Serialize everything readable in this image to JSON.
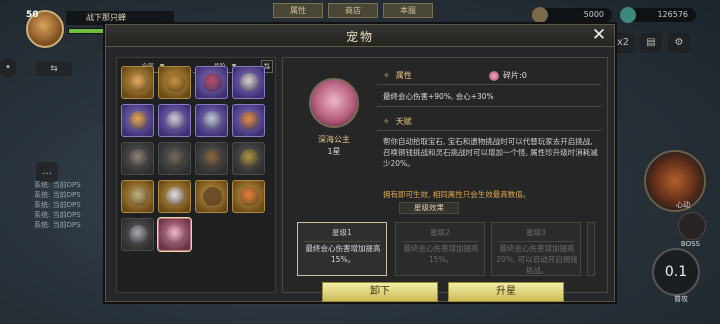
{
  "hud": {
    "level": "50",
    "player_name": "战下那只蝉",
    "top_tabs": [
      "属性",
      "商店",
      "本服"
    ],
    "gold": "5000",
    "gems": "126576",
    "speed": "x2",
    "boss_label": "BOSS",
    "skill_label": "心动",
    "auto_timer": "0.1",
    "auto_label": "普攻"
  },
  "chatlog": [
    "系统: 当前DPS",
    "系统: 当前DPS",
    "系统: 当前DPS",
    "系统: 当前DPS",
    "系统: 当前DPS"
  ],
  "modal": {
    "title": "宠物",
    "close_label": "✕"
  },
  "pet_list": {
    "filter_all": "全部",
    "filter_quality": "品阶",
    "cells": [
      {
        "rarity": "gold",
        "color": "#e6a85a"
      },
      {
        "rarity": "gold",
        "color": "#c98a3a"
      },
      {
        "rarity": "purple",
        "color": "#b94a66"
      },
      {
        "rarity": "purple",
        "color": "#d8d0c6"
      },
      {
        "rarity": "purple",
        "color": "#e5a44c"
      },
      {
        "rarity": "purple",
        "color": "#cfc9d8"
      },
      {
        "rarity": "purple",
        "color": "#b9c6d6"
      },
      {
        "rarity": "purple",
        "color": "#e08a3e"
      },
      {
        "rarity": "gray",
        "color": "#a89a8a"
      },
      {
        "rarity": "gray",
        "color": "#8a7a6a"
      },
      {
        "rarity": "gray",
        "color": "#a67a45"
      },
      {
        "rarity": "gray",
        "color": "#d2b04a"
      },
      {
        "rarity": "gold",
        "color": "#bcae7e"
      },
      {
        "rarity": "gold",
        "color": "#dcdcec"
      },
      {
        "rarity": "gold",
        "color": "#6a4a2a"
      },
      {
        "rarity": "gold",
        "color": "#e07a3a"
      },
      {
        "rarity": "gray",
        "color": "#c8ccd8"
      },
      {
        "rarity": "pink",
        "color": "#f2b2c8"
      }
    ]
  },
  "detail": {
    "name": "深海公主",
    "star": "1星",
    "attr_title": "属性",
    "fragments": "碎片:0",
    "attr_text": "最终会心伤害+90%, 会心+30%",
    "talent_title": "天赋",
    "talent_text": "帮你自动拾取宝石, 宝石和遗物挑战时可以代替玩家去开启挑战, 召唤铜钱挑战和灵石挑战时可以增加一个怪, 属性珍升级时消耗减少20%。",
    "talent_note": "拥有即可生效, 相同属性只会生效最高数值。",
    "star_effect_title": "星级效果",
    "star_cards": [
      {
        "title": "星级1",
        "desc": "最终会心伤害增加提高15%。",
        "state": "active"
      },
      {
        "title": "星级2",
        "desc": "最终会心伤害增加提高15%。",
        "state": "dim"
      },
      {
        "title": "星级3",
        "desc": "最终会心伤害增加提高20%, 可以自动开启铜钱挑战。",
        "state": "dim"
      }
    ],
    "unequip_label": "卸下",
    "upgrade_label": "升星"
  }
}
